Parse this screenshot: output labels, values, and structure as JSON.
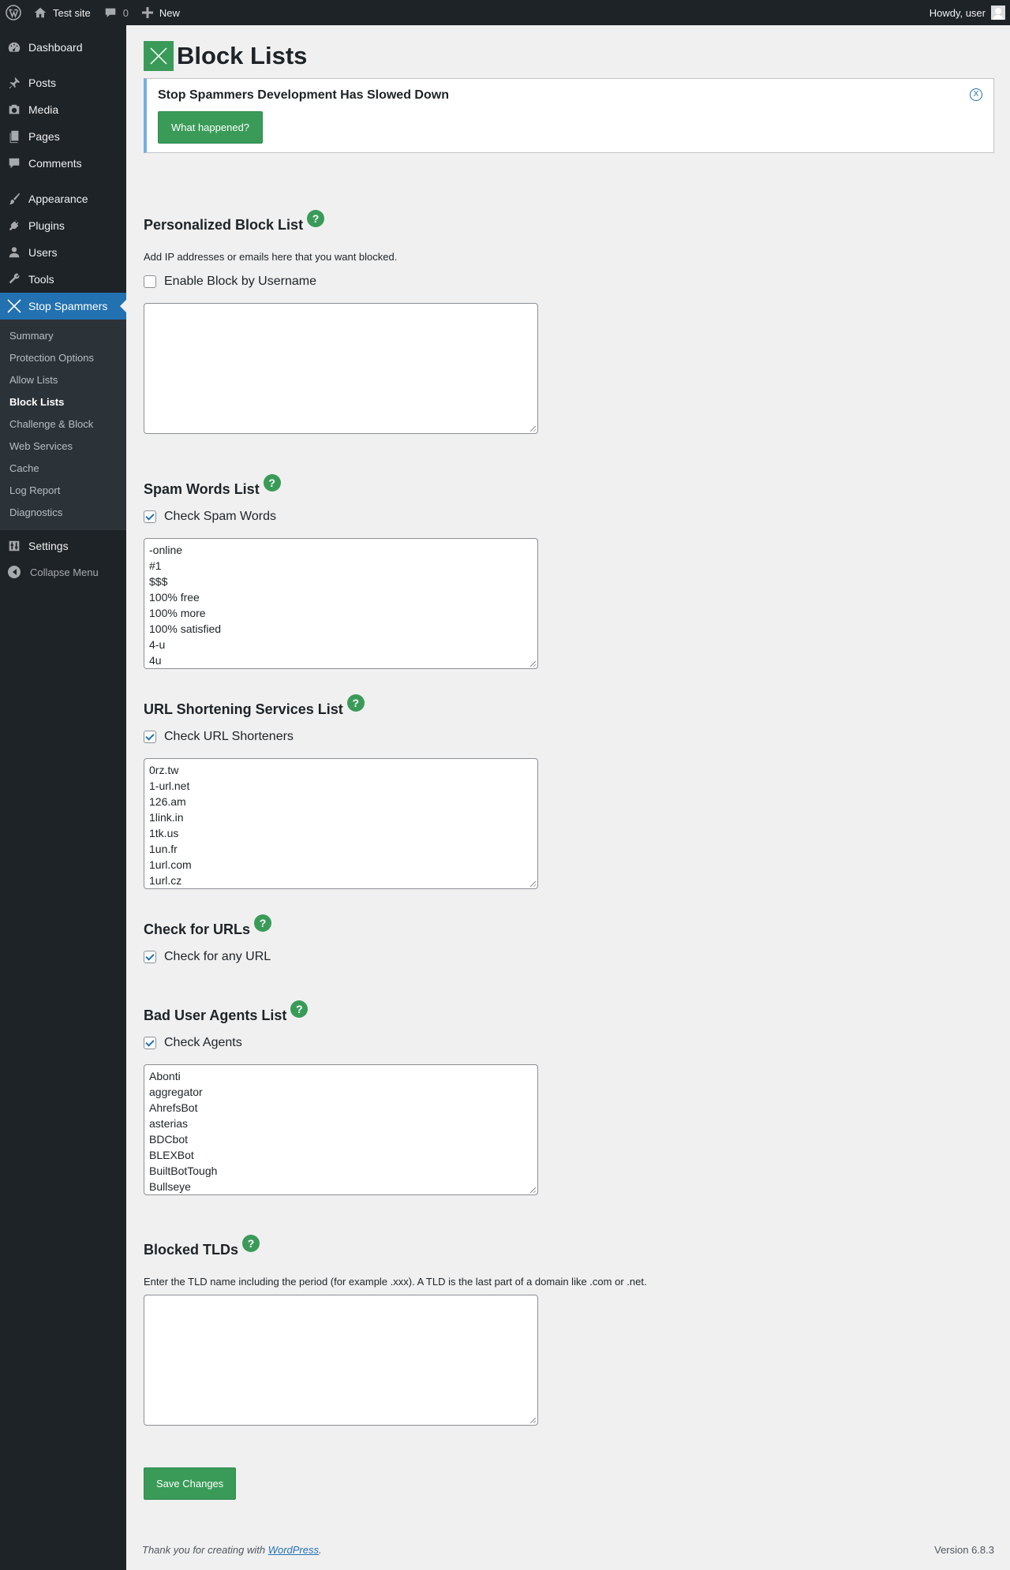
{
  "admin_bar": {
    "site_name": "Test site",
    "comments_count": "0",
    "new_label": "New",
    "howdy": "Howdy, user"
  },
  "sidebar": {
    "items": [
      {
        "label": "Dashboard",
        "icon": "dashboard-icon"
      },
      {
        "label": "Posts",
        "icon": "pushpin-icon"
      },
      {
        "label": "Media",
        "icon": "media-icon"
      },
      {
        "label": "Pages",
        "icon": "pages-icon"
      },
      {
        "label": "Comments",
        "icon": "comment-icon"
      },
      {
        "label": "Appearance",
        "icon": "paintbrush-icon"
      },
      {
        "label": "Plugins",
        "icon": "plug-icon"
      },
      {
        "label": "Users",
        "icon": "user-icon"
      },
      {
        "label": "Tools",
        "icon": "wrench-icon"
      },
      {
        "label": "Stop Spammers",
        "icon": "stop-spammers-icon"
      }
    ],
    "submenu": [
      "Summary",
      "Protection Options",
      "Allow Lists",
      "Block Lists",
      "Challenge & Block",
      "Web Services",
      "Cache",
      "Log Report",
      "Diagnostics"
    ],
    "settings": "Settings",
    "collapse": "Collapse Menu"
  },
  "page": {
    "title": "Block Lists",
    "notice_title": "Stop Spammers Development Has Slowed Down",
    "notice_button": "What happened?",
    "notice_close": "X"
  },
  "sections": {
    "personal": {
      "title": "Personalized Block List",
      "desc": "Add IP addresses or emails here that you want blocked.",
      "checkbox": "Enable Block by Username",
      "checked": false,
      "content": ""
    },
    "spam_words": {
      "title": "Spam Words List",
      "checkbox": "Check Spam Words",
      "checked": true,
      "content": "-online\n#1\n$$$\n100% free\n100% more\n100% satisfied\n4-u\n4u"
    },
    "url_short": {
      "title": "URL Shortening Services List",
      "checkbox": "Check URL Shorteners",
      "checked": true,
      "content": "0rz.tw\n1-url.net\n126.am\n1link.in\n1tk.us\n1un.fr\n1url.com\n1url.cz"
    },
    "check_urls": {
      "title": "Check for URLs",
      "checkbox": "Check for any URL",
      "checked": true
    },
    "bad_agents": {
      "title": "Bad User Agents List",
      "checkbox": "Check Agents",
      "checked": true,
      "content": "Abonti\naggregator\nAhrefsBot\nasterias\nBDCbot\nBLEXBot\nBuiltBotTough\nBullseye"
    },
    "tlds": {
      "title": "Blocked TLDs",
      "desc": "Enter the TLD name including the period (for example .xxx). A TLD is the last part of a domain like .com or .net.",
      "content": ""
    }
  },
  "help_glyph": "?",
  "save_button": "Save Changes",
  "footer": {
    "thanks_prefix": "Thank you for creating with ",
    "wordpress_link": "WordPress",
    "thanks_suffix": ".",
    "version": "Version 6.8.3"
  },
  "colors": {
    "adminbar": "#1d2327",
    "current_menu": "#2271b1",
    "plugin_green": "#3a9b58"
  }
}
